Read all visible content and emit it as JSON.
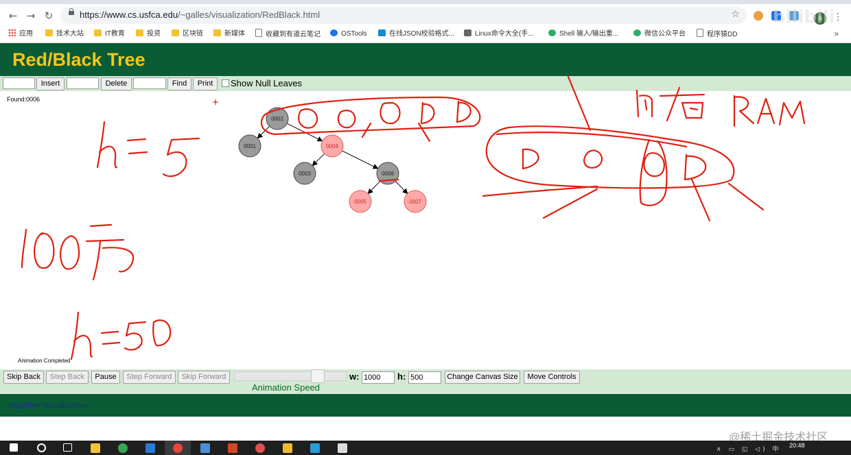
{
  "browser": {
    "url_host": "https://www.cs.usfca.edu",
    "url_path": "/~galles/visualization/RedBlack.html",
    "back_icon": "←",
    "forward_icon": "→",
    "reload_icon": "↻",
    "star_icon": "☆",
    "avatar_letter": "a",
    "menu_icon": "⋮"
  },
  "bookmarks": {
    "items": [
      {
        "label": "应用",
        "icon": "apps-icon"
      },
      {
        "label": "技术大站",
        "icon": "folder-icon"
      },
      {
        "label": "IT教育",
        "icon": "folder-icon"
      },
      {
        "label": "投资",
        "icon": "folder-icon"
      },
      {
        "label": "区块链",
        "icon": "folder-icon"
      },
      {
        "label": "新媒体",
        "icon": "folder-icon"
      },
      {
        "label": "收藏到有道云笔记",
        "icon": "document-icon"
      },
      {
        "label": "OSTools",
        "icon": "ostools-icon"
      },
      {
        "label": "在线JSON校验格式...",
        "icon": "json-icon"
      },
      {
        "label": "Linux命令大全(手...",
        "icon": "linux-icon"
      },
      {
        "label": "Shell 输入/输出重...",
        "icon": "shell-icon"
      },
      {
        "label": "微信公众平台",
        "icon": "wechat-icon"
      },
      {
        "label": "程序猿DD",
        "icon": "document-icon"
      }
    ],
    "more": "»"
  },
  "page": {
    "title": "Red/Black Tree",
    "controls": {
      "insert_label": "Insert",
      "delete_label": "Delete",
      "find_label": "Find",
      "print_label": "Print",
      "show_null_leaves_label": "Show Null Leaves"
    },
    "status": {
      "found": "Found:0006",
      "animation": "Animation Completed"
    },
    "tree": {
      "nodes": [
        {
          "key": "0002",
          "color": "black"
        },
        {
          "key": "0001",
          "color": "black"
        },
        {
          "key": "0004",
          "color": "red"
        },
        {
          "key": "0003",
          "color": "black"
        },
        {
          "key": "0006",
          "color": "black"
        },
        {
          "key": "0005",
          "color": "red"
        },
        {
          "key": "0007",
          "color": "red"
        }
      ]
    },
    "animation_controls": {
      "skip_back": "Skip Back",
      "step_back": "Step Back",
      "pause": "Pause",
      "step_forward": "Step Forward",
      "skip_forward": "Skip Forward",
      "speed_label": "Animation Speed",
      "w_label": "w:",
      "w_value": "1000",
      "h_label": "h:",
      "h_value": "500",
      "change_canvas_size": "Change Canvas Size",
      "move_controls": "Move Controls"
    },
    "footer_link": "Algorithm Visualizations"
  },
  "annotations": {
    "h5": "h=5",
    "hundred_wan": "100万",
    "h50": "h=50",
    "memory": "内存 RAM"
  },
  "overlay": {
    "watermark": "@稀土掘金技术社区",
    "bilibili": "bilibili",
    "plus": "+"
  },
  "taskbar": {
    "time": "20:48",
    "tray": "∧ ▭ ◱ ◁) 中"
  },
  "colors": {
    "header_bg": "#0a5c36",
    "title": "#f5c518",
    "controls_bg": "#d3e9d3",
    "black_node": "#9a9a9a",
    "red_node": "#ffa8a8",
    "red_node_text": "#c03030",
    "ink": "#e02010"
  }
}
